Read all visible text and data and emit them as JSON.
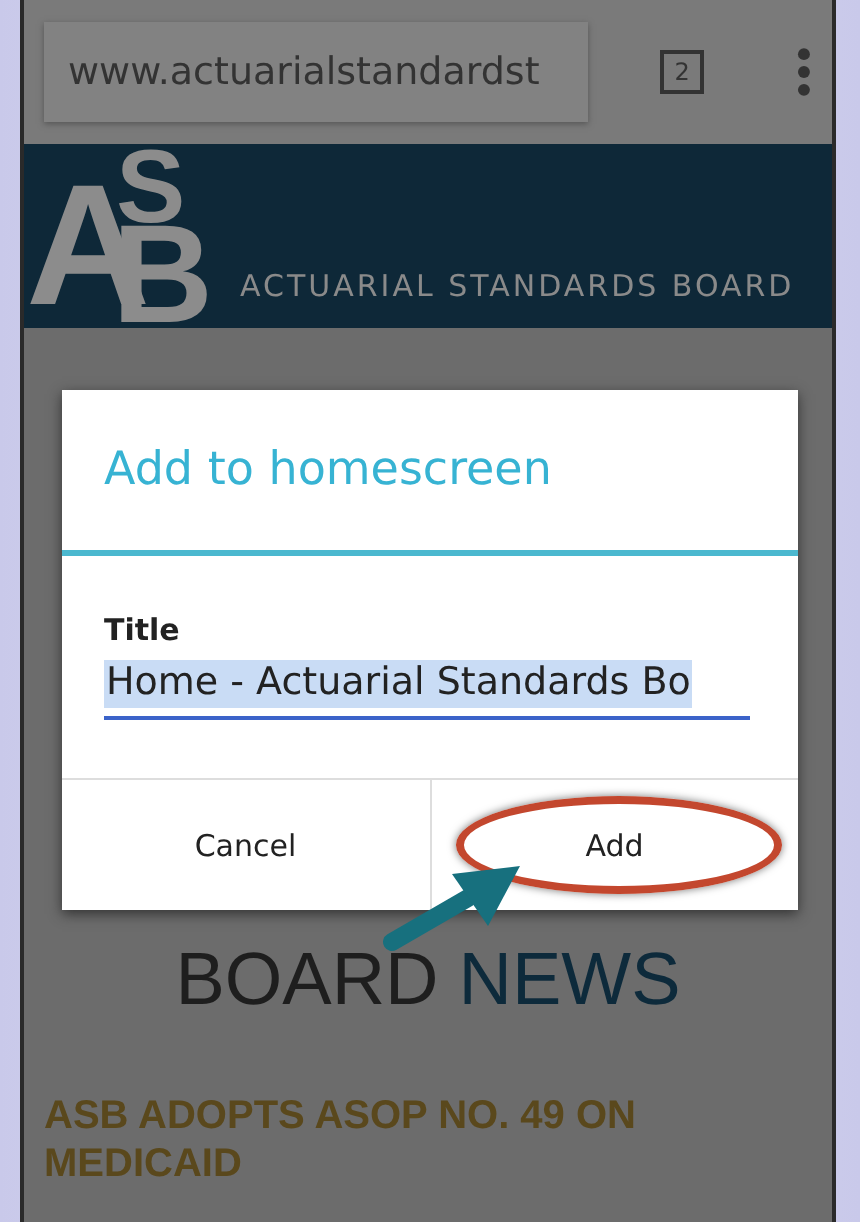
{
  "browser": {
    "url": "www.actuarialstandardst",
    "tab_count": "2"
  },
  "banner": {
    "logo_letters": [
      "A",
      "S",
      "B"
    ],
    "name": "ACTUARIAL STANDARDS BOARD"
  },
  "page": {
    "headline_line2": "BOARD",
    "headline_accent": "NEWS",
    "news_title": "ASB ADOPTS ASOP NO. 49 ON MEDICAID"
  },
  "dialog": {
    "title": "Add to homescreen",
    "field_label": "Title",
    "field_value": "Home - Actuarial Standards Bo",
    "buttons": [
      {
        "label": "Cancel",
        "highlighted": false
      },
      {
        "label": "Add",
        "highlighted": true
      }
    ]
  }
}
